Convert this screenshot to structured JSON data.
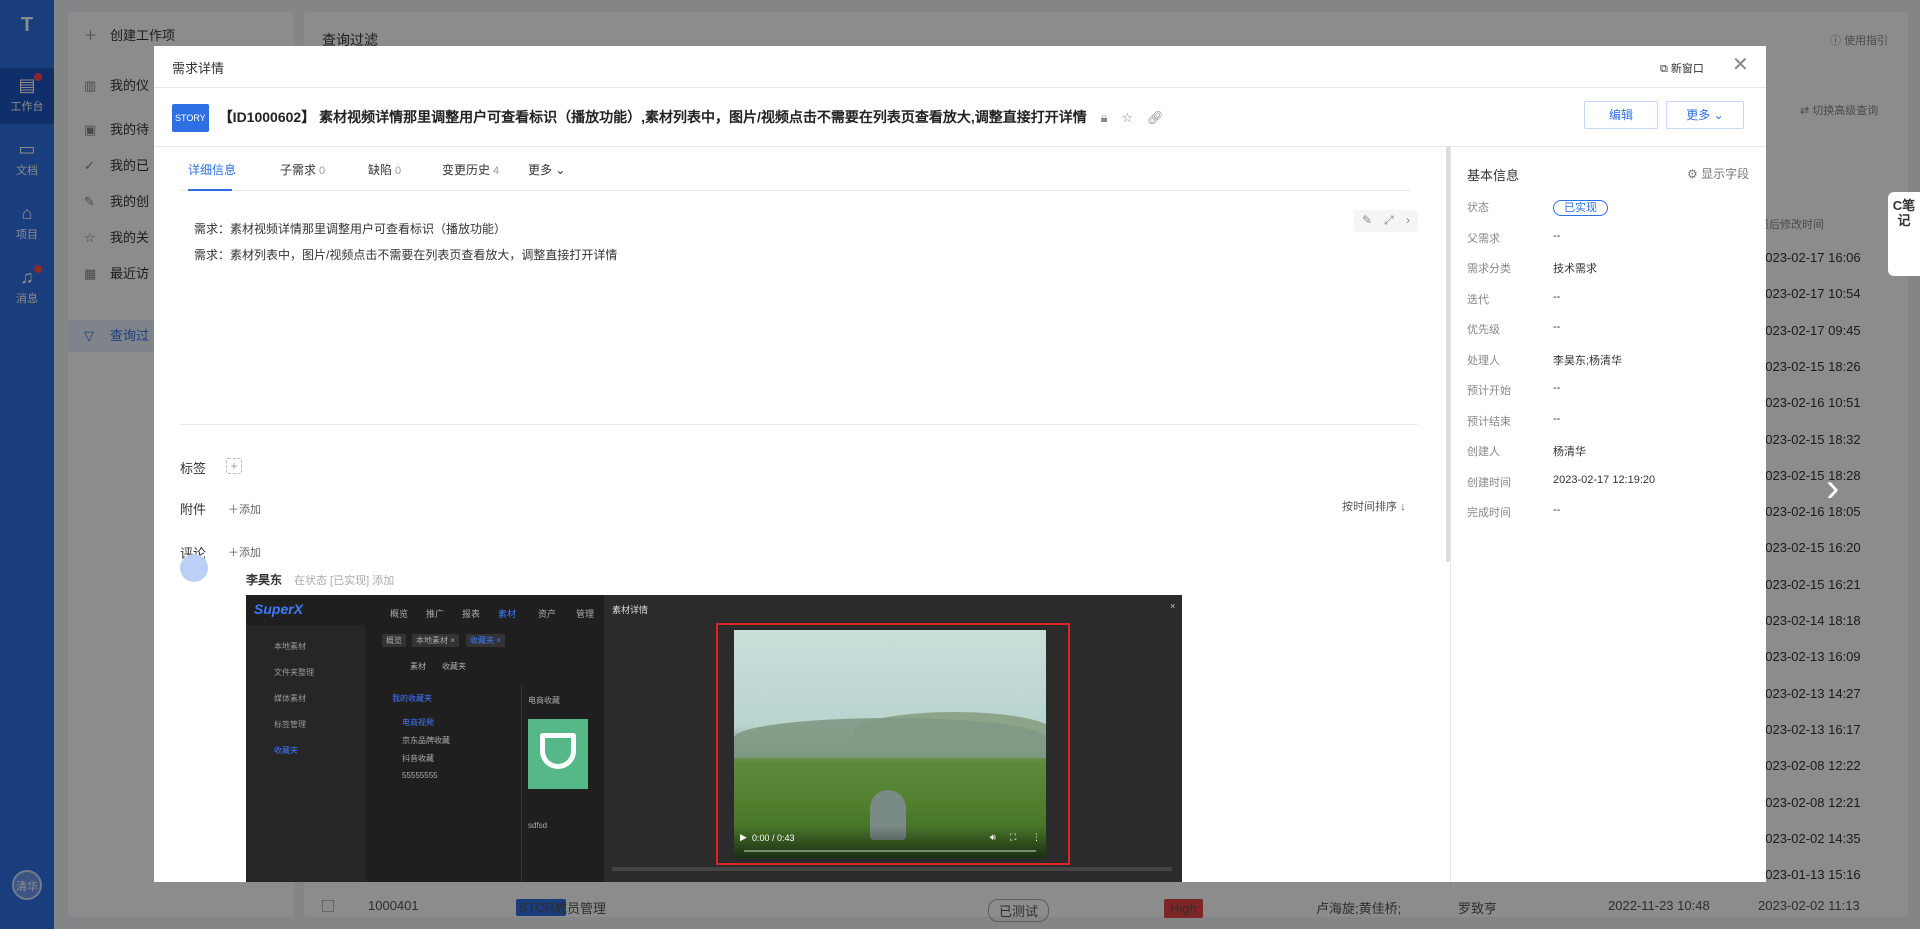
{
  "rail": {
    "logo": "T",
    "items": [
      {
        "label": "工作台"
      },
      {
        "label": "文档"
      },
      {
        "label": "项目"
      },
      {
        "label": "消息"
      }
    ],
    "user": "清华"
  },
  "background": {
    "sidebar": [
      "创建工作项",
      "我的仪",
      "我的待",
      "我的已",
      "我的创",
      "我的关",
      "最近访",
      "查询过"
    ],
    "page_title": "查询过滤",
    "help": "使用指引",
    "advanced": "切换高级查询",
    "col_header": "最后修改时间",
    "times": [
      "2023-02-17 16:06",
      "2023-02-17 10:54",
      "2023-02-17 09:45",
      "2023-02-15 18:26",
      "2023-02-16 10:51",
      "2023-02-15 18:32",
      "2023-02-15 18:28",
      "2023-02-16 18:05",
      "2023-02-15 16:20",
      "2023-02-15 16:21",
      "2023-02-14 18:18",
      "2023-02-13 16:09",
      "2023-02-13 14:27",
      "2023-02-13 16:17",
      "2023-02-08 12:22",
      "2023-02-08 12:21",
      "2023-02-02 14:35",
      "2023-01-13 15:16"
    ],
    "last_row": {
      "id": "1000401",
      "tag": "STORY",
      "title": "成员管理",
      "status": "已测试",
      "priority": "High",
      "owners": "卢海旋;黄佳桥;",
      "creator": "罗致亨",
      "created": "2022-11-23 10:48",
      "modified": "2023-02-02 11:13"
    },
    "note_btn": "C笔记"
  },
  "modal": {
    "header_title": "需求详情",
    "new_window": "新窗口",
    "story_tag": "STORY",
    "title": "【ID1000602】 素材视频详情那里调整用户可查看标识（播放功能）,素材列表中，图片/视频点击不需要在列表页查看放大,调整直接打开详情",
    "edit": "编辑",
    "more": "更多",
    "tabs": [
      {
        "label": "详细信息",
        "count": ""
      },
      {
        "label": "子需求",
        "count": "0"
      },
      {
        "label": "缺陷",
        "count": "0"
      },
      {
        "label": "变更历史",
        "count": "4"
      },
      {
        "label": "更多",
        "count": ""
      }
    ],
    "desc1": "需求：素材视频详情那里调整用户可查看标识（播放功能）",
    "desc2": "需求：素材列表中，图片/视频点击不需要在列表页查看放大，调整直接打开详情",
    "labels_title": "标签",
    "attach_title": "附件",
    "attach_add": "添加",
    "comment_title": "评论",
    "comment_add": "添加",
    "sort": "按时间排序",
    "comment": {
      "author": "李昊东",
      "meta": "在状态 [已实现] 添加"
    },
    "screenshot": {
      "brand": "SuperX",
      "nav": [
        "概览",
        "推广",
        "报表",
        "素材",
        "资产",
        "管理"
      ],
      "side": [
        "本地素材",
        "文件夹整理",
        "媒体素材",
        "标签管理",
        "收藏夹"
      ],
      "crumbs": [
        "概览",
        "本地素材 ×",
        "收藏夹 ×"
      ],
      "sub_tabs": [
        "素材",
        "收藏夹"
      ],
      "folders": [
        "我的收藏夹",
        "电商视频",
        "京东品牌收藏",
        "抖音收藏",
        "55555555"
      ],
      "panel_title": "电商收藏",
      "thumb_name": "sdfsd",
      "dialog_title": "素材详情",
      "video_time": "0:00 / 0:43"
    }
  },
  "right": {
    "title": "基本信息",
    "show_fields": "显示字段",
    "fields": [
      {
        "k": "状态",
        "v": "已实现"
      },
      {
        "k": "父需求",
        "v": "--"
      },
      {
        "k": "需求分类",
        "v": "技术需求"
      },
      {
        "k": "迭代",
        "v": "--"
      },
      {
        "k": "优先级",
        "v": "--"
      },
      {
        "k": "处理人",
        "v": "李昊东;杨清华"
      },
      {
        "k": "预计开始",
        "v": "--"
      },
      {
        "k": "预计结束",
        "v": "--"
      },
      {
        "k": "创建人",
        "v": "杨清华"
      },
      {
        "k": "创建时间",
        "v": "2023-02-17 12:19:20"
      },
      {
        "k": "完成时间",
        "v": "--"
      }
    ]
  }
}
